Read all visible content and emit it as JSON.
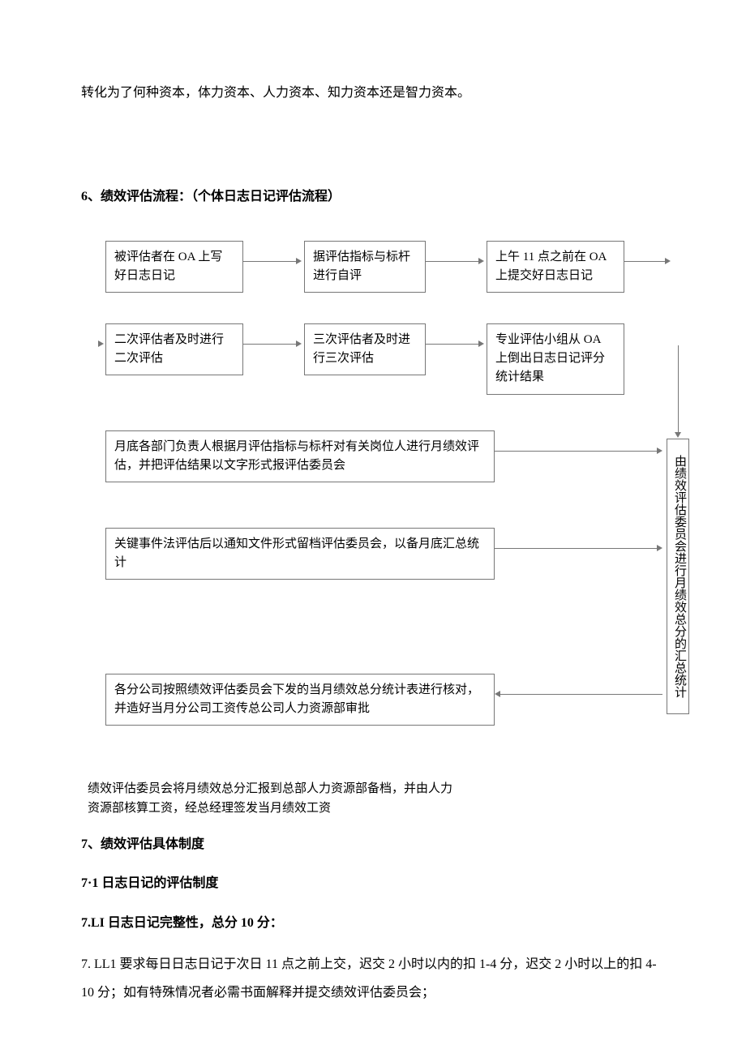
{
  "top_line": "转化为了何种资本，体力资本、人力资本、知力资本还是智力资本。",
  "section6": {
    "title": "6、绩效评估流程：（个体日志日记评估流程）"
  },
  "row1": {
    "b1": "被评估者在 OA 上写好日志日记",
    "b2": "据评估指标与标杆进行自评",
    "b3": "上午 11 点之前在 OA 上提交好日志日记"
  },
  "row2": {
    "b1": "二次评估者及时进行二次评估",
    "b2": "三次评估者及时进行三次评估",
    "b3": "专业评估小组从 OA 上倒出日志日记评分统计结果"
  },
  "mid": {
    "b1": "月底各部门负责人根据月评估指标与标杆对有关岗位人进行月绩效评估，并把评估结果以文字形式报评估委员会",
    "b2": "关键事件法评估后以通知文件形式留档评估委员会，以备月底汇总统计",
    "b3": "各分公司按照绩效评估委员会下发的当月绩效总分统计表进行核对，并造好当月分公司工资传总公司人力资源部审批",
    "vbox": "由绩效评估委员会进行月绩效总分的汇总统计"
  },
  "after_flow": "绩效评估委员会将月绩效总分汇报到总部人力资源部备档，并由人力资源部核算工资，经总经理签发当月绩效工资",
  "section7": {
    "t1": "7、绩效评估具体制度",
    "t2": "7·1 日志日记的评估制度",
    "t3": "7.LI 日志日记完整性，总分 10 分：",
    "t4": "7. LL1 要求每日日志日记于次日 11 点之前上交，迟交 2 小时以内的扣 1-4 分，迟交 2 小时以上的扣 4-10 分；如有特殊情况者必需书面解释并提交绩效评估委员会；"
  }
}
